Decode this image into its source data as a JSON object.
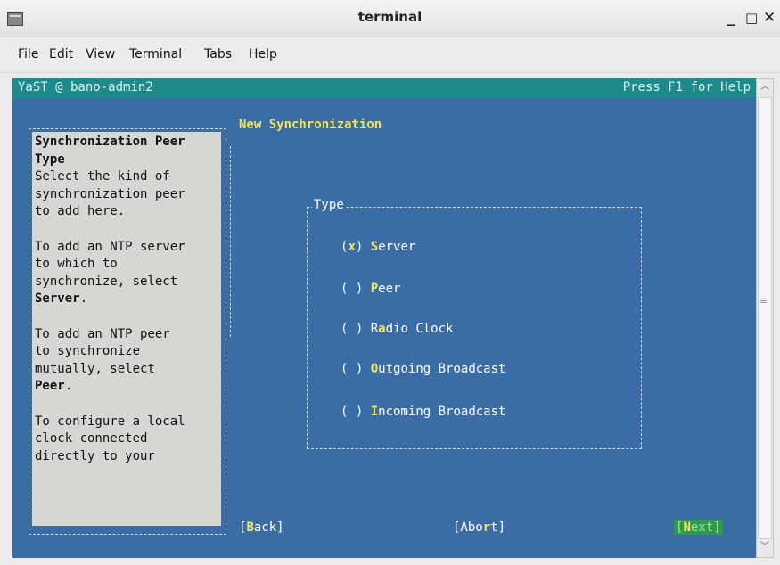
{
  "window": {
    "title": "terminal",
    "minimize": "_",
    "maximize": "□",
    "close": "✕"
  },
  "menu": [
    "File",
    "Edit",
    "View",
    "Terminal",
    "Tabs",
    "Help"
  ],
  "terminal": {
    "header_left": "YaST @ bano-admin2",
    "header_right": "Press F1 for Help"
  },
  "help": {
    "heading": "Synchronization Peer\nType",
    "p1": "Select the kind of\nsynchronization peer\nto add here.",
    "p2a": "To add an NTP server\nto which to\nsynchronize, select\n",
    "p2b": "Server",
    "p2c": ".",
    "p3a": "To add an NTP peer\nto synchronize\nmutually, select\n",
    "p3b": "Peer",
    "p3c": ".",
    "p4": "To configure a local\nclock connected\ndirectly to your"
  },
  "dialog": {
    "title": "New Synchronization",
    "frame_label": "Type",
    "options": [
      {
        "mark": "x",
        "hot": "S",
        "rest": "erver"
      },
      {
        "mark": " ",
        "hot": "P",
        "rest": "eer"
      },
      {
        "mark": " ",
        "pre": "R",
        "hot": "a",
        "rest": "dio Clock"
      },
      {
        "mark": " ",
        "hot": "O",
        "rest": "utgoing Broadcast"
      },
      {
        "mark": " ",
        "hot": "I",
        "rest": "ncoming Broadcast"
      }
    ]
  },
  "buttons": {
    "back": {
      "pre": "[",
      "hot": "B",
      "rest": "ack]"
    },
    "abort": {
      "pre": "[Abo",
      "hot": "r",
      "rest": "t]"
    },
    "next": {
      "pre": "[",
      "hot": "N",
      "rest": "ext]"
    }
  }
}
